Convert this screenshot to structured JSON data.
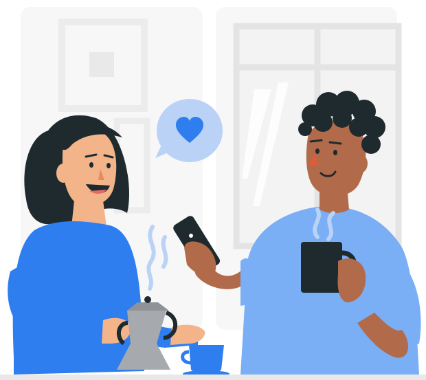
{
  "illustration": {
    "kind": "flat-vector",
    "subjects": [
      "woman-pouring-coffee",
      "man-with-phone-and-mug"
    ],
    "icons": {
      "speech_bubble": "heart-icon"
    },
    "colors": {
      "background": "#ffffff",
      "wall_panel": "#f6f6f6",
      "frame": "#ececec",
      "window_frame": "#e6e6e6",
      "window_glass": "#f3f3f3",
      "woman_shirt": "#2e7ef0",
      "man_shirt": "#7aaef5",
      "skin_woman": "#f3b48a",
      "skin_man": "#b26b4a",
      "hair": "#1f2a2e",
      "accent_blue": "#2e7ef0",
      "bubble": "#b9d2f6",
      "mug": "#1f2a2e",
      "kettle": "#a6aaaf",
      "steam": "#b9d2f6"
    }
  }
}
